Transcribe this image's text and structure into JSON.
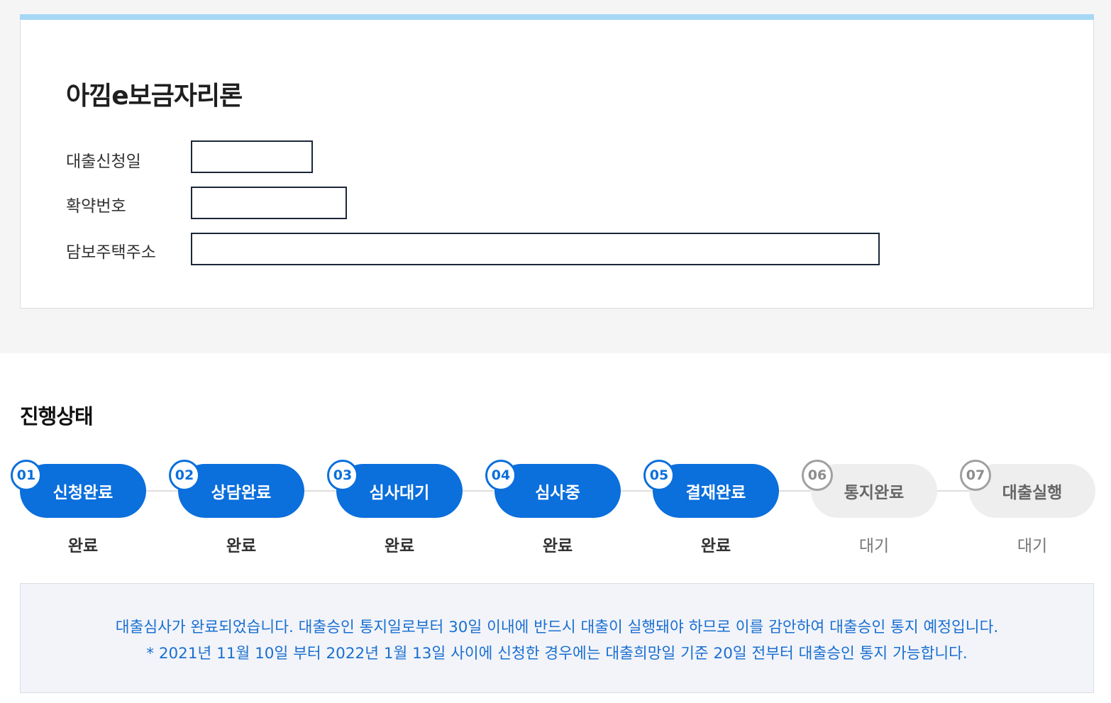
{
  "loan": {
    "title": "아낌e보금자리론",
    "fields": [
      {
        "label": "대출신청일",
        "value": ""
      },
      {
        "label": "확약번호",
        "value": ""
      },
      {
        "label": "담보주택주소",
        "value": ""
      }
    ]
  },
  "progress": {
    "title": "진행상태",
    "steps": [
      {
        "num": "01",
        "label": "신청완료",
        "status": "완료",
        "state": "done"
      },
      {
        "num": "02",
        "label": "상담완료",
        "status": "완료",
        "state": "done"
      },
      {
        "num": "03",
        "label": "심사대기",
        "status": "완료",
        "state": "done"
      },
      {
        "num": "04",
        "label": "심사중",
        "status": "완료",
        "state": "done"
      },
      {
        "num": "05",
        "label": "결재완료",
        "status": "완료",
        "state": "done"
      },
      {
        "num": "06",
        "label": "통지완료",
        "status": "대기",
        "state": "wait"
      },
      {
        "num": "07",
        "label": "대출실행",
        "status": "대기",
        "state": "wait"
      }
    ]
  },
  "notice": {
    "line1": "대출심사가 완료되었습니다. 대출승인 통지일로부터 30일 이내에 반드시 대출이 실행돼야 하므로 이를 감안하여 대출승인 통지 예정입니다.",
    "line2": "* 2021년 11월 10일 부터 2022년 1월 13일 사이에 신청한 경우에는 대출희망일 기준 20일 전부터 대출승인 통지 가능합니다."
  },
  "colors": {
    "accent": "#a6d7f5",
    "done": "#0b6fdc",
    "wait": "#eeeeee",
    "notice_text": "#1a6fd1"
  }
}
